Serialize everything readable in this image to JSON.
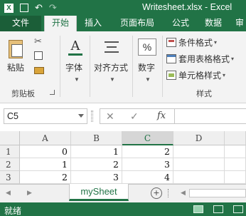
{
  "titlebar": {
    "title": "Writesheet.xlsx - Excel",
    "icons": [
      "excel-icon",
      "save-icon",
      "undo-icon",
      "redo-icon"
    ]
  },
  "tabs": [
    {
      "label": "文件",
      "active": false
    },
    {
      "label": "开始",
      "active": true
    },
    {
      "label": "插入",
      "active": false
    },
    {
      "label": "页面布局",
      "active": false
    },
    {
      "label": "公式",
      "active": false
    },
    {
      "label": "数据",
      "active": false
    }
  ],
  "ribbon": {
    "clipboard": {
      "paste": "粘贴",
      "group": "剪贴板"
    },
    "font": {
      "label": "字体"
    },
    "alignment": {
      "label": "对齐方式"
    },
    "number": {
      "label": "数字",
      "symbol": "%"
    },
    "styles": {
      "group": "样式",
      "items": [
        "条件格式",
        "套用表格格式",
        "单元格样式"
      ]
    }
  },
  "formula_bar": {
    "name_box": "C5",
    "fx": "fx",
    "cancel": "✕",
    "enter": "✓",
    "value": ""
  },
  "grid": {
    "columns": [
      "A",
      "B",
      "C",
      "D"
    ],
    "selected_column": "C",
    "rows": [
      {
        "num": "1",
        "cells": [
          "0",
          "1",
          "2",
          ""
        ]
      },
      {
        "num": "2",
        "cells": [
          "1",
          "2",
          "3",
          ""
        ]
      },
      {
        "num": "3",
        "cells": [
          "2",
          "3",
          "4",
          ""
        ]
      }
    ]
  },
  "sheets": {
    "active": "mySheet"
  },
  "status": {
    "text": "就绪"
  },
  "colors": {
    "accent": "#217346",
    "ribbon": "#f3f3f3"
  }
}
